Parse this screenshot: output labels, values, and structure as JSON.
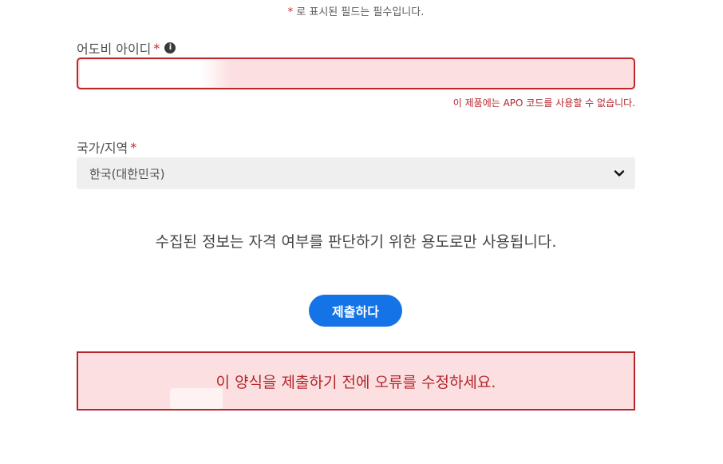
{
  "form": {
    "required_note_star": "*",
    "required_note_text": " 로 표시된 필드는 필수입니다.",
    "adobe_id": {
      "label": "어도비 아이디",
      "required_mark": "*",
      "info_icon": "info-icon",
      "value": "",
      "error": "이 제품에는 APO 코드를 사용할 수 없습니다."
    },
    "country": {
      "label": "국가/지역",
      "required_mark": "*",
      "selected": "한국(대한민국)",
      "dropdown_icon": "chevron-down-icon"
    },
    "usage_note": "수집된 정보는 자격 여부를 판단하기 위한 용도로만 사용됩니다.",
    "submit_label": "제출하다",
    "form_error": "이 양식을 제출하기 전에 오류를 수정하세요."
  },
  "colors": {
    "accent": "#1473e6",
    "error": "#b3262c",
    "error_bg": "#fce0e1",
    "select_bg": "#efefef"
  }
}
